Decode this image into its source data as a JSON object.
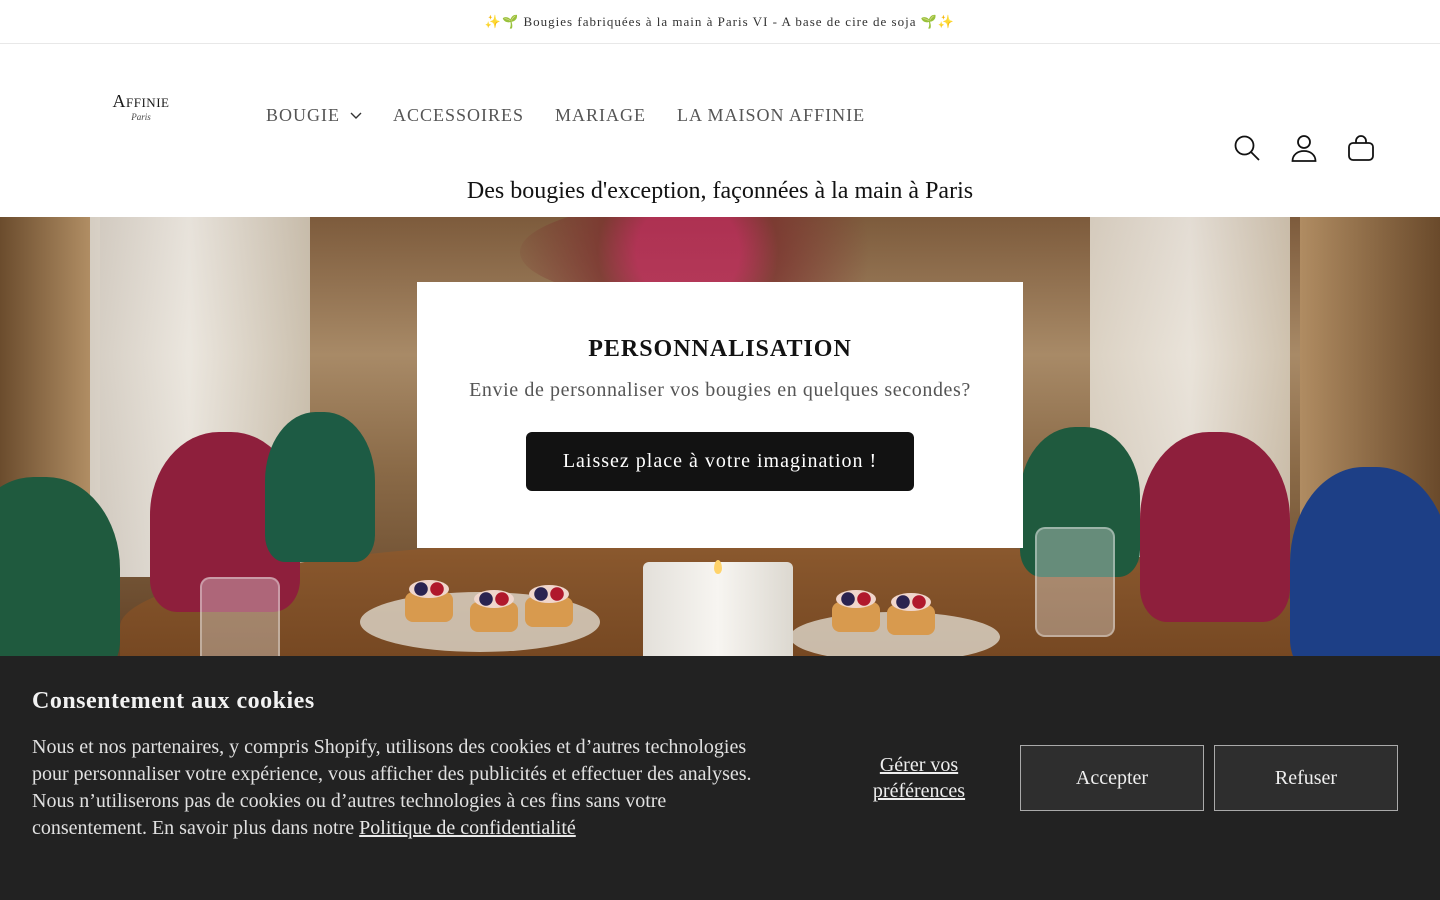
{
  "announcement": "✨🌱 Bougies fabriquées à la main à Paris VI - A base de cire de soja 🌱✨",
  "logo": {
    "name": "Affinie",
    "sub": "Paris"
  },
  "nav": {
    "items": [
      {
        "label": "BOUGIE",
        "has_dropdown": true
      },
      {
        "label": "ACCESSOIRES"
      },
      {
        "label": "MARIAGE"
      },
      {
        "label": "LA MAISON AFFINIE"
      }
    ]
  },
  "header_icons": [
    "search-icon",
    "account-icon",
    "cart-icon"
  ],
  "tagline": "Des bougies d'exception, façonnées à la main à Paris",
  "personnalisation": {
    "title": "PERSONNALISATION",
    "text": "Envie de personnaliser vos bougies en quelques secondes?",
    "button": "Laissez place à votre imagination !"
  },
  "cookie": {
    "title": "Consentement aux cookies",
    "text": "Nous et nos partenaires, y compris Shopify, utilisons des cookies et d’autres technologies pour personnaliser votre expérience, vous afficher des publicités et effectuer des analyses. Nous n’utiliserons pas de cookies ou d’autres technologies à ces fins sans votre consentement. En savoir plus dans notre ",
    "link": "Politique de confidentialité",
    "manage": "Gérer vos préférences",
    "accept": "Accepter",
    "refuse": "Refuser"
  },
  "colors": {
    "button_bg": "#121212",
    "cookie_bg": "#222222",
    "text": "#121212"
  }
}
